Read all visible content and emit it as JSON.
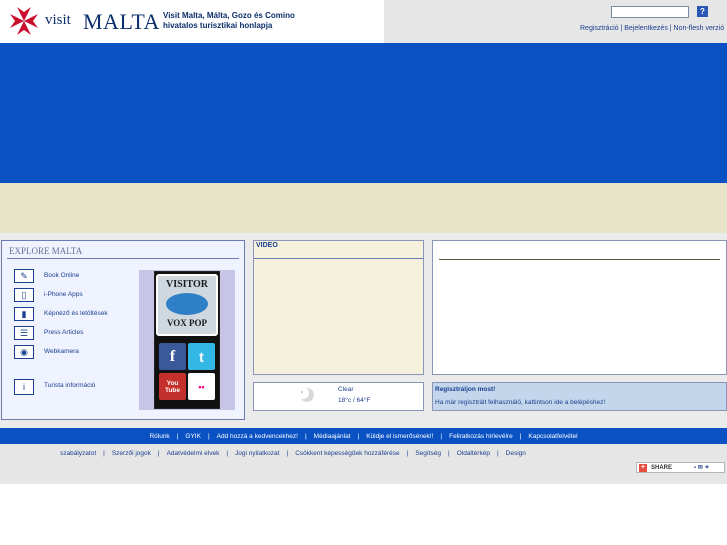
{
  "header": {
    "logo_visit": "visit",
    "logo_malta": "MALTA",
    "tagline_line1": "Visit Malta, Málta, Gozo és Comino",
    "tagline_line2": "hivatalos turisztikai honlapja",
    "search_placeholder": "",
    "search_button": "?",
    "links": [
      "Regisztráció",
      "Bejelentkezés",
      "Non-flesh verzió"
    ]
  },
  "explore": {
    "title": "EXPLORE MALTA",
    "items": [
      {
        "label": "Book Online",
        "icon": "booking-icon"
      },
      {
        "label": "i-Phone Apps",
        "icon": "phone-icon"
      },
      {
        "label": "Képnéző és letöltések",
        "icon": "gallery-icon"
      },
      {
        "label": "Press Articles",
        "icon": "news-icon"
      },
      {
        "label": "Webkamera",
        "icon": "webcam-icon"
      },
      {
        "label": "Turista információ",
        "icon": "info-icon"
      }
    ],
    "promo_top": "VISITOR",
    "promo_bottom": "VOX POP",
    "social": [
      "f",
      "t",
      "You Tube",
      "••"
    ]
  },
  "video": {
    "title": "VIDEO"
  },
  "weather": {
    "condition": "Clear",
    "temperature": "18°c / 64°F"
  },
  "register": {
    "title": "Regisztráljon most!",
    "text": "Ha már regisztrált felhasználó, kattintson ide a belépéshez!"
  },
  "footer_nav": [
    "Rólunk",
    "GYIK",
    "Add hozzá a kedvencekhez!",
    "Médiaajánlat",
    "Küldje el ismerősének!!",
    "Feliratkozás hírlevélre",
    "Kapcsolatfelvétel"
  ],
  "footer_nav2": [
    "szabályzatot",
    "Szerzői jogok",
    "Adatvédelmi elvek",
    "Jogi nyilatkozat",
    "Csökkent képességűek hozzáférése",
    "Segítség",
    "Oldaltérkép",
    "Design"
  ],
  "share": {
    "label": "SHARE"
  },
  "colors": {
    "primary_blue": "#0a52c4",
    "beige": "#e8e4c7",
    "link": "#1b3f8f"
  }
}
